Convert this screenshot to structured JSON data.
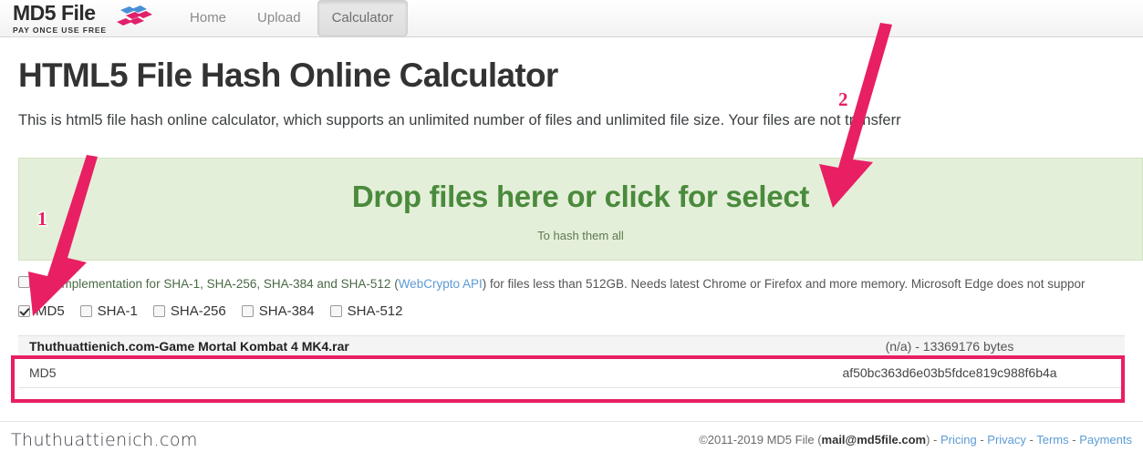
{
  "navbar": {
    "brand_title": "MD5 File",
    "brand_subtitle": "PAY ONCE USE FREE",
    "logo_icon": "diamond-blocks-logo",
    "links": [
      {
        "label": "Home",
        "active": false
      },
      {
        "label": "Upload",
        "active": false
      },
      {
        "label": "Calculator",
        "active": true
      }
    ]
  },
  "main": {
    "title": "HTML5 File Hash Online Calculator",
    "lead": "This is html5 file hash online calculator, which supports an unlimited number of files and unlimited file size. Your files are not transferr"
  },
  "dropzone": {
    "title": "Drop files here or click for select",
    "subtitle": "To hash them all"
  },
  "note": {
    "text_before_link": "test implementation for SHA-1, SHA-256, SHA-384 and SHA-512 (",
    "link_label": "WebCrypto API",
    "text_after_link": ") for files less than 512GB. Needs latest Chrome or Firefox and more memory. Microsoft Edge does not suppor",
    "checkbox_checked": false
  },
  "algorithms": [
    {
      "label": "MD5",
      "checked": true
    },
    {
      "label": "SHA-1",
      "checked": false
    },
    {
      "label": "SHA-256",
      "checked": false
    },
    {
      "label": "SHA-384",
      "checked": false
    },
    {
      "label": "SHA-512",
      "checked": false
    }
  ],
  "results": {
    "file_name": "Thuthuattienich.com-Game Mortal Kombat 4 MK4.rar",
    "file_meta": "(n/a) - 13369176 bytes",
    "hash_label": "MD5",
    "hash_value": "af50bc363d6e03b5fdce819c988f6b4a"
  },
  "footer": {
    "copyright": "©2011-2019 MD5 File (",
    "email": "mail@md5file.com",
    "after_email": ") - ",
    "links": [
      {
        "label": "Pricing"
      },
      {
        "label": "Privacy"
      },
      {
        "label": "Terms"
      },
      {
        "label": "Payments"
      }
    ],
    "separator": " - ",
    "watermark": "Thuthuattienich.com"
  },
  "annotations": {
    "marker_1": "1",
    "marker_2": "2",
    "arrow_color": "#e81f63",
    "highlight_color": "#e91e63"
  },
  "colors": {
    "accent_green": "#4a8a3c",
    "dropzone_bg": "#e4efd9",
    "link_blue": "#5b9bd5",
    "logo_blue": "#4a8fd6",
    "logo_pink": "#e0216c"
  }
}
